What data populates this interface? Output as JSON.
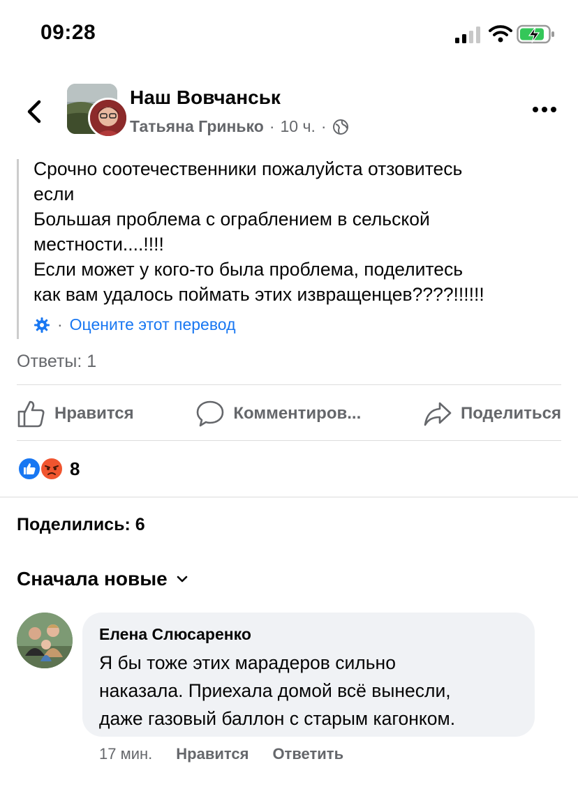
{
  "status_bar": {
    "time": "09:28"
  },
  "post": {
    "group_name": "Наш Вовчанськ",
    "author": "Татьяна Гринько",
    "time_ago": "10 ч.",
    "text": "Срочно соотечественники пожалуйста отзовитесь\nесли\nБольшая проблема с ограблением в сельской\nместности....!!!!\nЕсли может у кого-то была проблема, поделитесь\nкак вам удалось поймать этих извращенцев????!!!!!!",
    "translate_label": "Оцените этот перевод",
    "replies": "Ответы: 1",
    "actions": {
      "like": "Нравится",
      "comment": "Комментиров...",
      "share": "Поделиться"
    },
    "reaction_count": "8",
    "shares": "Поделились: 6",
    "sort_label": "Сначала новые"
  },
  "comment": {
    "author": "Елена Слюсаренко",
    "text": "Я бы тоже этих марадеров сильно\nнаказала. Приехала домой всё вынесли,\nдаже газовый баллон с старым кагонком.",
    "time_ago": "17 мин.",
    "like": "Нравится",
    "reply": "Ответить"
  },
  "colors": {
    "accent": "#1877f2",
    "secondary_text": "#65676b",
    "battery_green": "#34c759",
    "angry": "#f0552f"
  }
}
